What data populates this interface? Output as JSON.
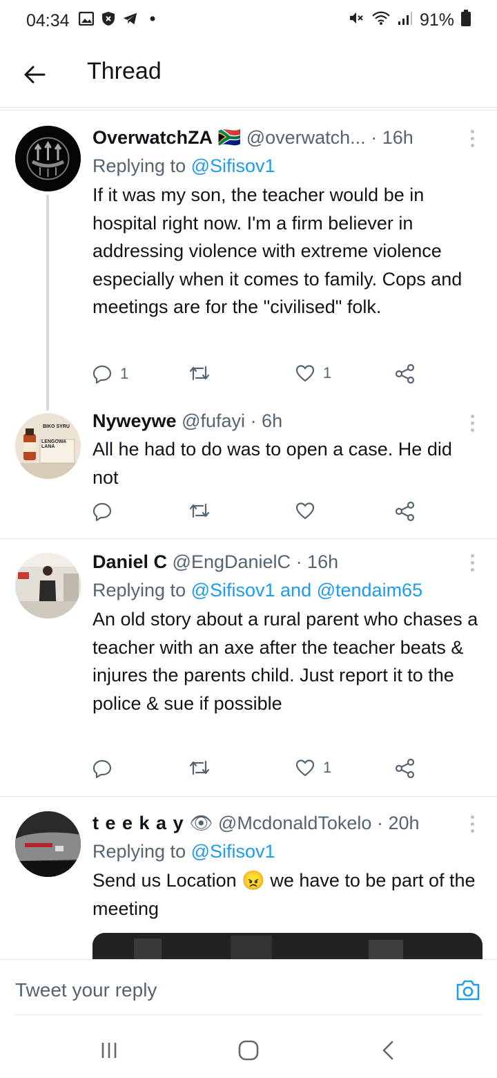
{
  "status_bar": {
    "time": "04:34",
    "battery": "91%"
  },
  "header": {
    "title": "Thread"
  },
  "tweets": [
    {
      "name": "OverwatchZA",
      "flag": "🇿🇦",
      "handle": "@overwatch...",
      "time": "· 16h",
      "replying_prefix": "Replying to ",
      "replying_to": "@Sifisov1",
      "text": "If it was my son, the teacher would be in hospital right now. I'm a firm believer in addressing violence with extreme violence especially when it comes to family. Cops and meetings are for the \"civilised\"  folk.",
      "replies": "1",
      "likes": "1"
    },
    {
      "name": "Nyweywe",
      "handle": "@fufayi",
      "time": "· 6h",
      "text": "All he had to do was to open a case. He did not",
      "avatar_text_1": "BIKO SYRU",
      "avatar_text_2": "LENGOWA LANA"
    },
    {
      "name": "Daniel C",
      "handle": "@EngDanielC",
      "time": "· 16h",
      "replying_prefix": "Replying to ",
      "replying_to": "@Sifisov1 and @tendaim65",
      "text": "An old story about a rural parent who chases a teacher with an axe after the teacher beats & injures the parents child. Just report it to the police & sue if possible",
      "likes": "1"
    },
    {
      "name": "t e e k a y",
      "emoji": "👁",
      "handle": "@McdonaldTokelo",
      "time": "· 20h",
      "replying_prefix": "Replying to ",
      "replying_to": "@Sifisov1",
      "text_before": "Send us Location",
      "text_emoji": "😠",
      "text_after": " we have to be part of the meeting"
    }
  ],
  "reply_bar": {
    "placeholder": "Tweet your reply"
  },
  "colors": {
    "link": "#1d9bf0",
    "muted": "#536471",
    "text": "#0f1419",
    "divider": "#e6e6e6"
  }
}
